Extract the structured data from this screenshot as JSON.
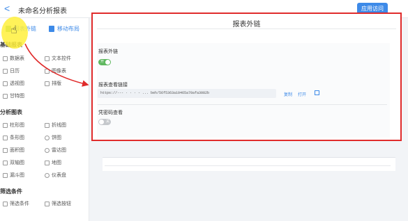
{
  "topbar": {
    "back_glyph": "<",
    "title": "未命名分析报表",
    "visit_button": "应用访问"
  },
  "sidebar": {
    "tabs": [
      {
        "label": "报表外链",
        "icon": "link-icon"
      },
      {
        "label": "移动布局",
        "icon": "mobile-icon"
      }
    ],
    "sections": [
      {
        "title": "基础报表",
        "items": [
          "数据表",
          "文本控件",
          "日历",
          "图像表",
          "透视图",
          "排版",
          "甘特图"
        ]
      },
      {
        "title": "分析图表",
        "items": [
          "柱形图",
          "折线图",
          "条形图",
          "饼图",
          "面积图",
          "雷达图",
          "双轴图",
          "地图",
          "漏斗图",
          "仪表盘"
        ]
      },
      {
        "title": "筛选条件",
        "items": [
          "筛选条件",
          "筛选按钮"
        ]
      }
    ]
  },
  "dialog": {
    "title": "报表外链",
    "external_link_label": "报表外链",
    "external_link_toggle": "开",
    "view_link_label": "报表查看链接",
    "view_link_url": "https://--- · · · - ... beh/56f5363a10465a70afa3082b",
    "copy_label": "复制",
    "open_label": "打开",
    "password_label": "凭密码查看",
    "password_toggle": "关"
  },
  "colors": {
    "accent": "#3d8ae8",
    "toggle_on": "#5fb85f",
    "highlight_border": "#e02b2b"
  }
}
